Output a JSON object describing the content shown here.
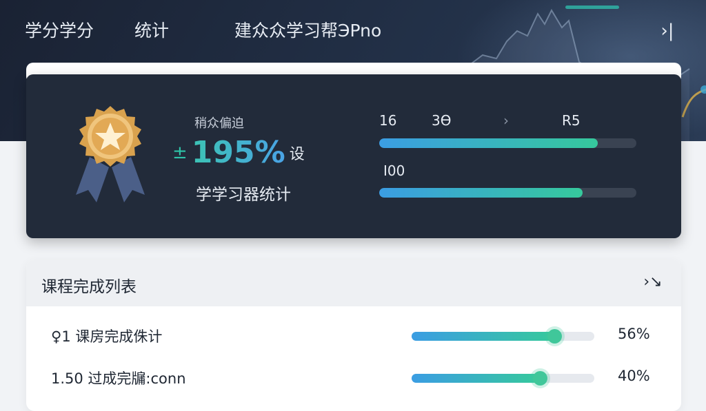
{
  "nav": {
    "items": [
      "学分学分",
      "统计"
    ],
    "title": "建众众学习帮ЭPno",
    "close_icon": "collapse-right-icon"
  },
  "stats": {
    "badge_icon": "star-medal-icon",
    "small_label": "稍众偏迫",
    "plus_minus": "±",
    "big_value": "195%",
    "big_suffix": "设",
    "sub_label": "学学习器统计",
    "bars": [
      {
        "labels": [
          "16",
          "3Ѳ",
          "›",
          "R5"
        ],
        "progress": 0.85
      },
      {
        "labels": [
          "I00"
        ],
        "progress": 0.79
      }
    ],
    "colors": {
      "accent_start": "#3b9de3",
      "accent_end": "#36c99c",
      "card_bg": "#222b3a"
    }
  },
  "list": {
    "title": "课程完成列表",
    "header_icon": "expand-arrow-icon",
    "rows": [
      {
        "label": "♀1 课房完成侏计",
        "percent": "56%",
        "progress": 0.78
      },
      {
        "label": "1.50 过成完牖:conn",
        "percent": "40%",
        "progress": 0.7
      }
    ]
  }
}
